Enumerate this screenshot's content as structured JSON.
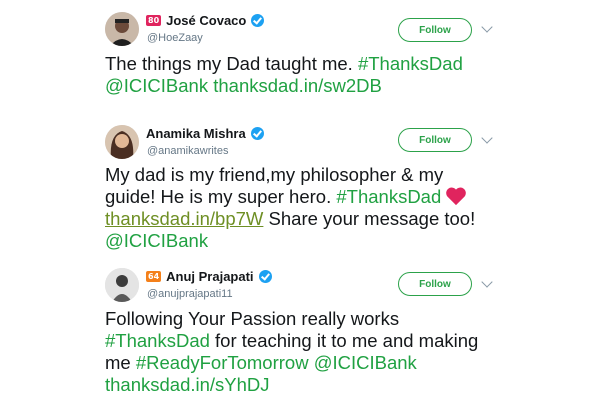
{
  "tweets": [
    {
      "rank_badge": "80",
      "display_name": "José Covaco",
      "handle": "@HoeZaay",
      "follow_label": "Follow",
      "text_plain": "The things my Dad taught me. ",
      "hashtag": "#ThanksDad",
      "mention": "@ICICIBank",
      "link": "thanksdad.in/sw2DB"
    },
    {
      "display_name": "Anamika Mishra",
      "handle": "@anamikawrites",
      "follow_label": "Follow",
      "line1": "My dad is my friend,my philosopher & my",
      "line2_plain": "guide! He is my super hero. ",
      "hashtag": "#ThanksDad",
      "link": "thanksdad.in/bp7W",
      "line3_plain": " Share your message too!",
      "mention": "@ICICIBank",
      "heart_icon": "heart-icon"
    },
    {
      "rank_badge": "64",
      "display_name": "Anuj Prajapati",
      "handle": "@anujprajapati11",
      "follow_label": "Follow",
      "line1": "Following Your Passion really works",
      "hashtag1": "#ThanksDad",
      "line2_plain": " for teaching it to me and making",
      "line3_plain": "me ",
      "hashtag2": "#ReadyForTomorrow",
      "mention": "@ICICIBank",
      "link": "thanksdad.in/sYhDJ"
    }
  ],
  "colors": {
    "green_accent": "#20a142",
    "follow_border": "#2ca24a",
    "link_olive": "#6e8f24",
    "verified_blue": "#1da1f2",
    "handle_gray": "#657786",
    "heart_red": "#e0245e"
  }
}
